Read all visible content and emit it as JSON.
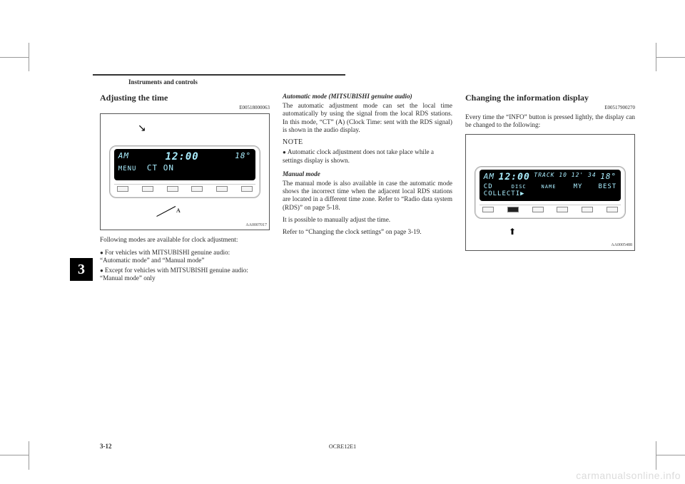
{
  "header": {
    "section": "Instruments and controls"
  },
  "chapter": "3",
  "col1": {
    "heading": "Adjusting the time",
    "docid": "E00518000063",
    "illus_id": "AA0007017",
    "radio": {
      "band": "AM",
      "clock": "12:00",
      "temp": "18",
      "menu": "MENU",
      "status": "CT ON",
      "label_a": "A"
    },
    "intro": "Following modes are available for clock adjustment:",
    "bullet1_a": "For vehicles with MITSUBISHI genuine audio:",
    "bullet1_b": "“Automatic mode” and “Manual mode”",
    "bullet2_a": "Except for vehicles with MITSUBISHI genuine audio:",
    "bullet2_b": "“Manual mode” only"
  },
  "col2": {
    "h_auto": "Automatic mode (MITSUBISHI genuine audio)",
    "p_auto": "The automatic adjustment mode can set the local time automatically by using the signal from the local RDS stations. In this mode, “CT” (A) (Clock Time: sent with the RDS signal) is shown in the audio display.",
    "note_hd": "NOTE",
    "note_item": "Automatic clock adjustment does not take place while a settings display is shown.",
    "h_manual": "Manual mode",
    "p_manual1": "The manual mode is also available in case the automatic mode shows the incorrect time when the adjacent local RDS stations are located in a different time zone. Refer to “Radio data system (RDS)” on page 5-18.",
    "p_manual2": "It is possible to manually adjust the time.",
    "p_manual3": "Refer to “Changing the clock settings” on page 3-19."
  },
  "col3": {
    "heading": "Changing the information display",
    "docid": "E00517900270",
    "p1": "Every time the “INFO” button is pressed lightly, the display can be changed to the following:",
    "illus_id": "AA0005488",
    "radio": {
      "band": "AM",
      "clock": "12:00",
      "track_label": "TRACK",
      "track": "10  12' 34",
      "temp": "18",
      "source": "CD",
      "disc_label": "DISC NAME",
      "disc_name": "MY BEST COLLECTI"
    }
  },
  "footer": {
    "page": "3-12",
    "book": "OCRE12E1"
  },
  "watermark": "carmanualsonline.info"
}
